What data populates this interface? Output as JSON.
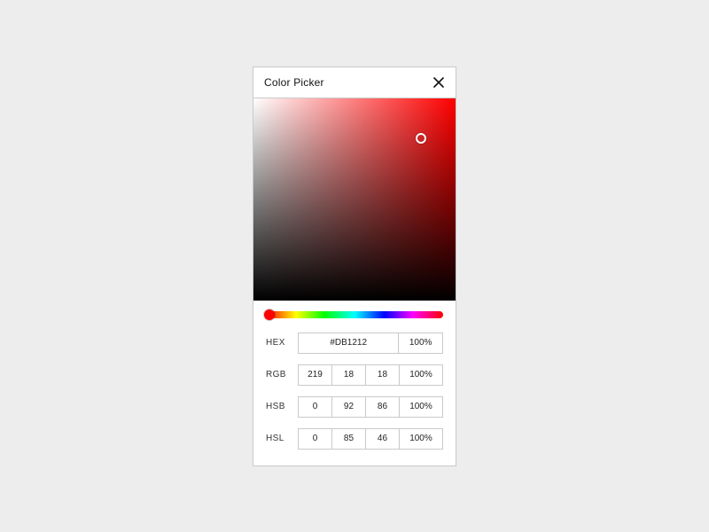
{
  "title": "Color Picker",
  "hue_hex": "#ff0000",
  "hex": {
    "label": "HEX",
    "value": "#DB1212",
    "alpha": "100%"
  },
  "rgb": {
    "label": "RGB",
    "r": "219",
    "g": "18",
    "b": "18",
    "alpha": "100%"
  },
  "hsb": {
    "label": "HSB",
    "h": "0",
    "s": "92",
    "b": "86",
    "alpha": "100%"
  },
  "hsl": {
    "label": "HSL",
    "h": "0",
    "s": "85",
    "l": "46",
    "alpha": "100%"
  }
}
